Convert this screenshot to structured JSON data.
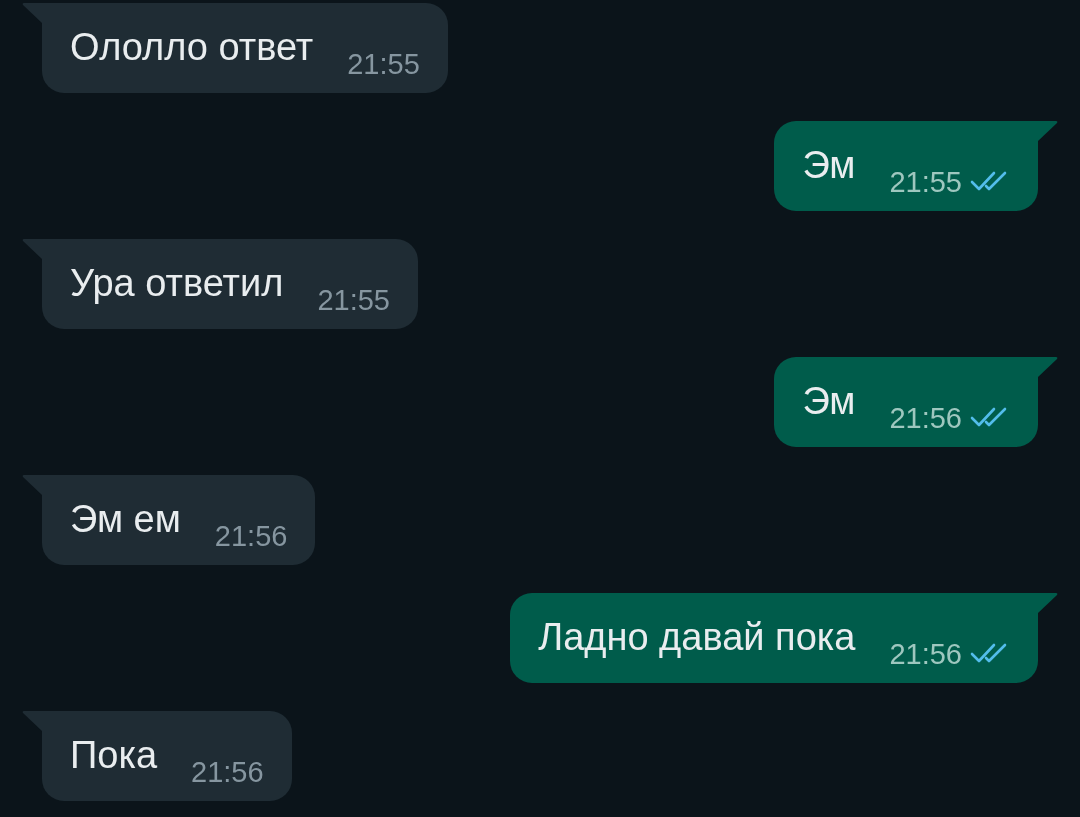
{
  "messages": [
    {
      "kind": "in",
      "text": "Ололло ответ",
      "time": "21:55"
    },
    {
      "kind": "out",
      "text": "Эм",
      "time": "21:55",
      "read": true
    },
    {
      "kind": "in",
      "text": "Ура ответил",
      "time": "21:55"
    },
    {
      "kind": "out",
      "text": "Эм",
      "time": "21:56",
      "read": true
    },
    {
      "kind": "in",
      "text": "Эм ем",
      "time": "21:56"
    },
    {
      "kind": "out",
      "text": "Ладно давай пока",
      "time": "21:56",
      "read": true
    },
    {
      "kind": "in",
      "text": "Пока",
      "time": "21:56"
    }
  ]
}
